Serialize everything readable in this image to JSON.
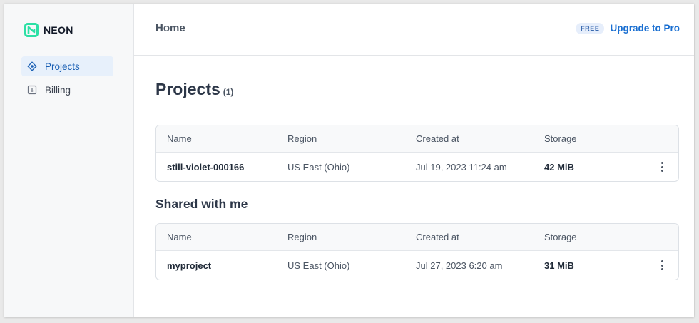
{
  "brand": {
    "name": "NEON",
    "accent": "#1a6fd1",
    "logo_color": "#2de0a5"
  },
  "sidebar": {
    "items": [
      {
        "label": "Projects",
        "icon": "projects-icon",
        "active": true
      },
      {
        "label": "Billing",
        "icon": "billing-icon",
        "active": false
      }
    ]
  },
  "header": {
    "breadcrumb": "Home",
    "plan_badge": "FREE",
    "upgrade_label": "Upgrade to Pro"
  },
  "projects": {
    "title": "Projects",
    "count": "(1)",
    "columns": [
      "Name",
      "Region",
      "Created at",
      "Storage"
    ],
    "rows": [
      {
        "name": "still-violet-000166",
        "region": "US East (Ohio)",
        "created": "Jul 19, 2023 11:24 am",
        "storage": "42 MiB"
      }
    ]
  },
  "shared": {
    "title": "Shared with me",
    "columns": [
      "Name",
      "Region",
      "Created at",
      "Storage"
    ],
    "rows": [
      {
        "name": "myproject",
        "region": "US East (Ohio)",
        "created": "Jul 27, 2023 6:20 am",
        "storage": "31 MiB"
      }
    ]
  }
}
